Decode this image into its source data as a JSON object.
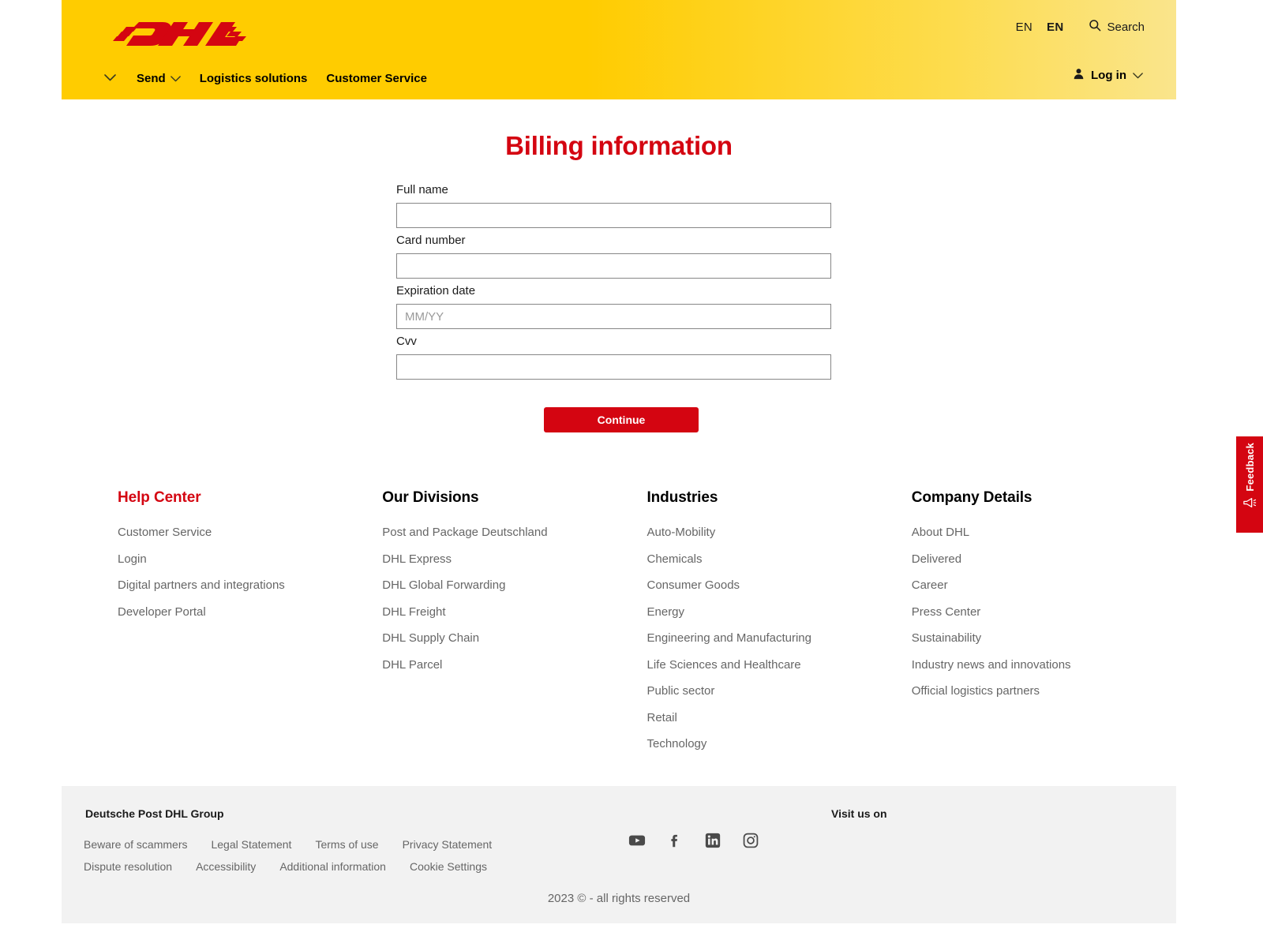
{
  "header": {
    "logo_alt": "DHL",
    "lang_primary": "EN",
    "lang_secondary": "EN",
    "search_label": "Search",
    "login_label": "Log in",
    "nav": [
      {
        "label": "Send",
        "has_chevron": true
      },
      {
        "label": "Logistics solutions",
        "has_chevron": false
      },
      {
        "label": "Customer Service",
        "has_chevron": false
      }
    ]
  },
  "main": {
    "title": "Billing information",
    "fields": [
      {
        "label": "Full name",
        "value": "",
        "placeholder": ""
      },
      {
        "label": "Card number",
        "value": "",
        "placeholder": ""
      },
      {
        "label": "Expiration date",
        "value": "",
        "placeholder": "MM/YY"
      },
      {
        "label": "Cvv",
        "value": "",
        "placeholder": ""
      }
    ],
    "submit_label": "Continue"
  },
  "footer_columns": [
    {
      "title": "Help Center",
      "title_color": "#D40511",
      "links": [
        "Customer Service",
        "Login",
        "Digital partners and integrations",
        "Developer Portal"
      ]
    },
    {
      "title": "Our Divisions",
      "title_color": "#000000",
      "links": [
        "Post and Package Deutschland",
        "DHL Express",
        "DHL Global Forwarding",
        "DHL Freight",
        "DHL Supply Chain",
        "DHL Parcel"
      ]
    },
    {
      "title": "Industries",
      "title_color": "#000000",
      "links": [
        "Auto-Mobility",
        "Chemicals",
        "Consumer Goods",
        "Energy",
        "Engineering and Manufacturing",
        "Life Sciences and Healthcare",
        "Public sector",
        "Retail",
        "Technology"
      ]
    },
    {
      "title": "Company Details",
      "title_color": "#000000",
      "links": [
        "About DHL",
        "Delivered",
        "Career",
        "Press Center",
        "Sustainability",
        "Industry news and innovations",
        "Official logistics partners"
      ]
    }
  ],
  "footer_bar": {
    "brand": "Deutsche Post DHL Group",
    "visit_label": "Visit us on",
    "legal_links": [
      "Beware of scammers",
      "Legal Statement",
      "Terms of use",
      "Privacy Statement",
      "Dispute resolution",
      "Accessibility",
      "Additional information",
      "Cookie Settings"
    ],
    "socials": [
      {
        "name": "youtube-icon"
      },
      {
        "name": "facebook-icon"
      },
      {
        "name": "linkedin-icon"
      },
      {
        "name": "instagram-icon"
      }
    ],
    "copyright": "2023 © - all rights reserved"
  },
  "feedback": {
    "label": "Feedback",
    "color": "#D40511"
  }
}
